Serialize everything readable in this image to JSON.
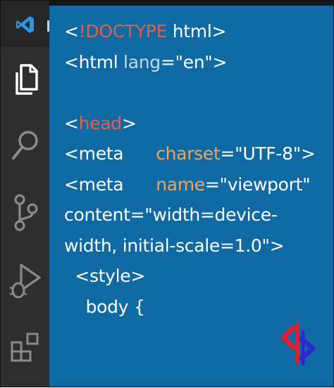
{
  "activity_bar": {
    "icons": [
      "vscode-logo-icon",
      "files-icon",
      "search-icon",
      "source-control-icon",
      "run-debug-icon",
      "extensions-icon"
    ]
  },
  "editor": {
    "lines": [
      {
        "parts": [
          {
            "t": "<",
            "c": "plain"
          },
          {
            "t": "!DOCTYPE",
            "c": "red"
          },
          {
            "t": " html>",
            "c": "plain"
          }
        ]
      },
      {
        "parts": [
          {
            "t": "<html ",
            "c": "plain"
          },
          {
            "t": "lang",
            "c": "dim"
          },
          {
            "t": "=\"en\">",
            "c": "plain"
          }
        ]
      },
      {
        "parts": [
          {
            "t": "",
            "c": "plain"
          }
        ]
      },
      {
        "parts": [
          {
            "t": "<",
            "c": "plain"
          },
          {
            "t": "head",
            "c": "red"
          },
          {
            "t": ">",
            "c": "plain"
          }
        ]
      },
      {
        "parts": [
          {
            "t": "<meta      ",
            "c": "plain"
          },
          {
            "t": "charset",
            "c": "orange"
          },
          {
            "t": "=\"UTF-8\">",
            "c": "plain"
          }
        ]
      },
      {
        "parts": [
          {
            "t": "<meta      ",
            "c": "plain"
          },
          {
            "t": "name",
            "c": "orange"
          },
          {
            "t": "=\"viewport\"",
            "c": "plain"
          }
        ]
      },
      {
        "parts": [
          {
            "t": "content=\"width=device-",
            "c": "plain"
          }
        ]
      },
      {
        "parts": [
          {
            "t": "width, initial-scale=1.0\">",
            "c": "plain"
          }
        ]
      },
      {
        "parts": [
          {
            "t": "  <style>",
            "c": "plain"
          }
        ]
      },
      {
        "parts": [
          {
            "t": "    body {",
            "c": "plain"
          }
        ]
      }
    ]
  },
  "colors": {
    "editor_bg": "#0f6aa4",
    "activity_bg": "#2e2e2e",
    "keyword_red": "#e35d4a",
    "attr_orange": "#f0a45e"
  }
}
